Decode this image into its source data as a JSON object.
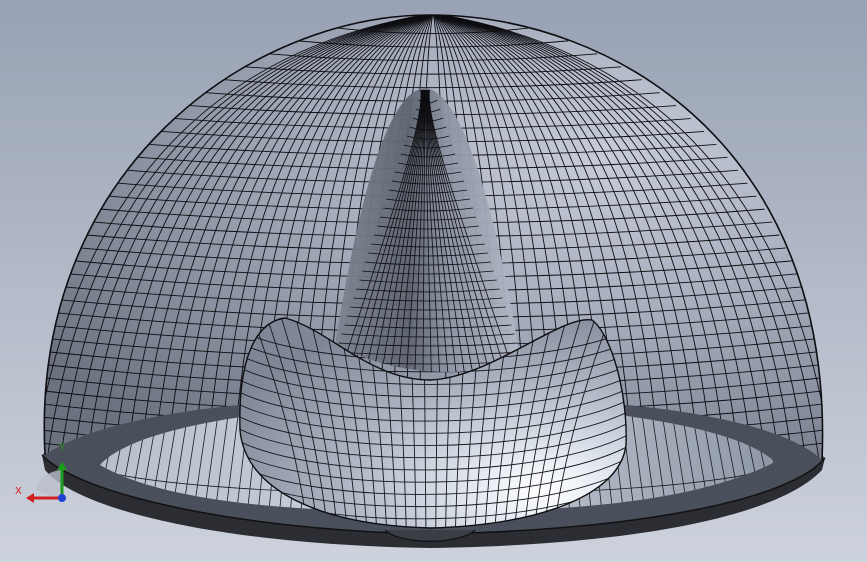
{
  "viewport": {
    "background_top": "#98a2b4",
    "background_bottom": "#cdd2dc",
    "mesh_color": "#0e0e12",
    "surface_light": "#e2e7ef",
    "surface_mid": "#9fa7b8",
    "surface_dark": "#5a616d"
  },
  "triad": {
    "x_label": "X",
    "y_label": "Y",
    "x_color": "#d0201e",
    "y_color": "#1c9a1c",
    "z_color": "#1f3fd6"
  }
}
